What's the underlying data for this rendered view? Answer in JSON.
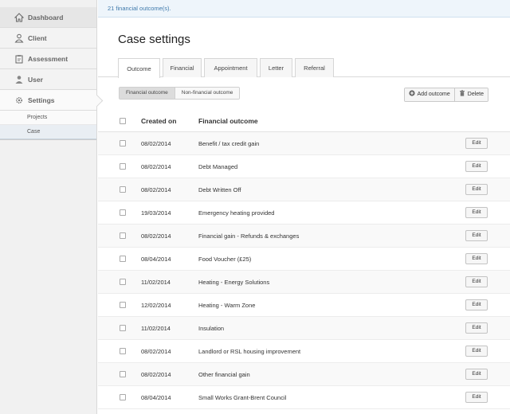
{
  "sidebar": {
    "items": [
      {
        "label": "Dashboard",
        "icon": "home-icon"
      },
      {
        "label": "Client",
        "icon": "person-icon"
      },
      {
        "label": "Assessment",
        "icon": "clipboard-icon"
      },
      {
        "label": "User",
        "icon": "user-icon"
      },
      {
        "label": "Settings",
        "icon": "gear-icon"
      }
    ],
    "sub_items": [
      {
        "label": "Projects"
      },
      {
        "label": "Case"
      }
    ]
  },
  "alert": {
    "text": "21 financial outcome(s)."
  },
  "page": {
    "title": "Case settings"
  },
  "tabs": [
    {
      "label": "Outcome"
    },
    {
      "label": "Financial"
    },
    {
      "label": "Appointment"
    },
    {
      "label": "Letter"
    },
    {
      "label": "Referral"
    }
  ],
  "toggle": {
    "financial": "Financial outcome",
    "non_financial": "Non-financial outcome"
  },
  "toolbar": {
    "add_label": "Add outcome",
    "delete_label": "Delete"
  },
  "table": {
    "headers": {
      "created_on": "Created on",
      "outcome": "Financial outcome"
    },
    "edit_label": "Edit",
    "rows": [
      {
        "date": "08/02/2014",
        "name": "Benefit / tax credit gain"
      },
      {
        "date": "08/02/2014",
        "name": "Debt Managed"
      },
      {
        "date": "08/02/2014",
        "name": "Debt Written Off"
      },
      {
        "date": "19/03/2014",
        "name": "Emergency heating provided"
      },
      {
        "date": "08/02/2014",
        "name": "Financial gain - Refunds & exchanges"
      },
      {
        "date": "08/04/2014",
        "name": "Food Voucher (£25)"
      },
      {
        "date": "11/02/2014",
        "name": "Heating - Energy Solutions"
      },
      {
        "date": "12/02/2014",
        "name": "Heating - Warm Zone"
      },
      {
        "date": "11/02/2014",
        "name": "Insulation"
      },
      {
        "date": "08/02/2014",
        "name": "Landlord or RSL housing improvement"
      },
      {
        "date": "08/02/2014",
        "name": "Other financial gain"
      },
      {
        "date": "08/04/2014",
        "name": "Small Works Grant-Brent Council"
      }
    ]
  }
}
